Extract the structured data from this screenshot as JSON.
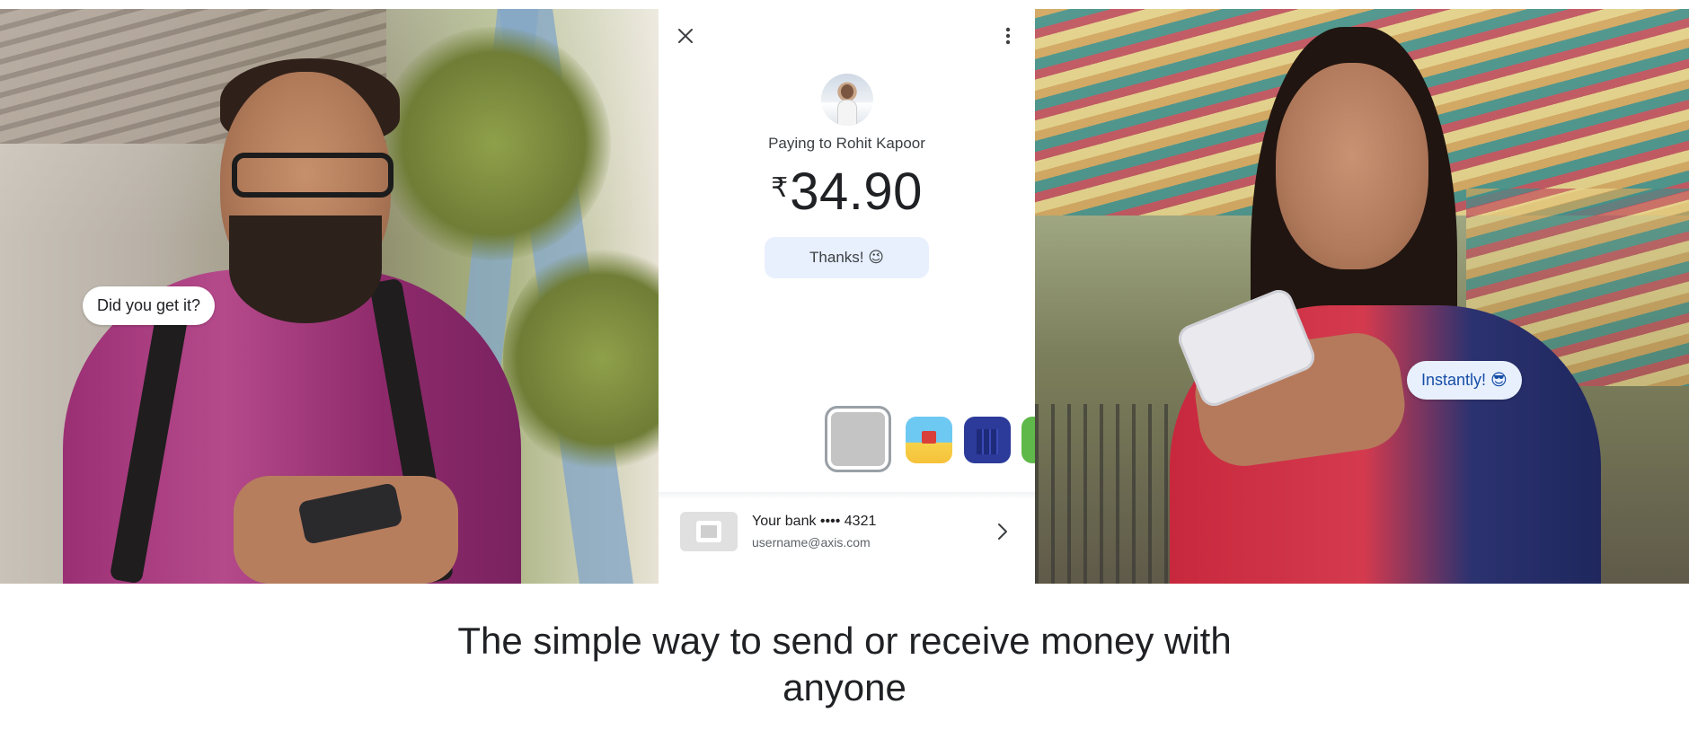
{
  "hero": {
    "left_bubble": "Did you get it?",
    "right_bubble": "Instantly! 😎"
  },
  "payment": {
    "paying_to": "Paying to Rohit Kapoor",
    "currency_symbol": "₹",
    "amount": "34.90",
    "note": "Thanks! 😉",
    "bank_name": "Your bank •••• 4321",
    "bank_email": "username@axis.com"
  },
  "headline": "The simple way to send or receive money with anyone",
  "colors": {
    "accent_bubble": "#e8f0fe",
    "accent_text": "#174ea6",
    "text_primary": "#202124",
    "text_secondary": "#5f6368"
  },
  "icons": {
    "close": "close-icon",
    "more": "more-vert-icon",
    "chevron": "chevron-right-icon"
  }
}
